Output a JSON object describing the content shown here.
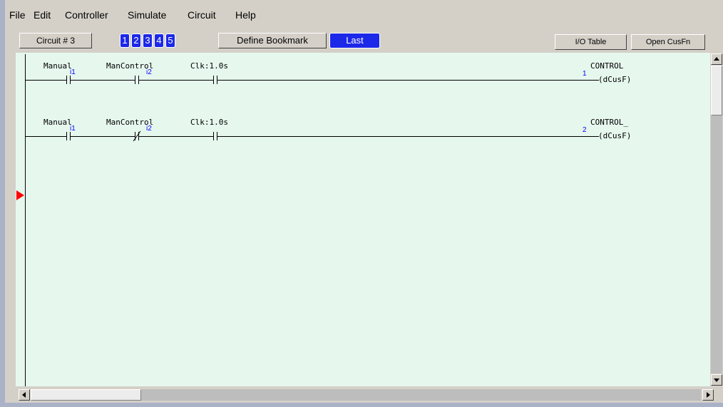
{
  "menu": {
    "items": [
      "File",
      "Edit",
      "Controller",
      "Simulate",
      "Circuit",
      "Help"
    ]
  },
  "toolbar": {
    "circuit_label": "Circuit # 3",
    "bookmarks": [
      "1",
      "2",
      "3",
      "4",
      "5"
    ],
    "define_bookmark_label": "Define Bookmark",
    "last_label": "Last",
    "io_table_label": "I/O Table",
    "open_cusfn_label": "Open CusFn"
  },
  "rungs": [
    {
      "number": "1",
      "contacts": [
        {
          "label": "Manual",
          "address": "i1",
          "type": "normally-open"
        },
        {
          "label": "ManControl",
          "address": "i2",
          "type": "normally-open"
        },
        {
          "label": "Clk:1.0s",
          "address": "",
          "type": "normally-open"
        }
      ],
      "coil_name": "CONTROL",
      "coil_text": "(dCusF)"
    },
    {
      "number": "2",
      "contacts": [
        {
          "label": "Manual",
          "address": "i1",
          "type": "normally-open"
        },
        {
          "label": "ManControl",
          "address": "i2",
          "type": "normally-closed"
        },
        {
          "label": "Clk:1.0s",
          "address": "",
          "type": "normally-open"
        }
      ],
      "coil_name": "CONTROL_",
      "coil_text": "(dCusF)"
    }
  ],
  "colors": {
    "canvas_bg": "#e6f7ee",
    "bookmark_blue": "#1c28e8",
    "address_blue": "#0000ff",
    "cursor_red": "#ff0000"
  }
}
